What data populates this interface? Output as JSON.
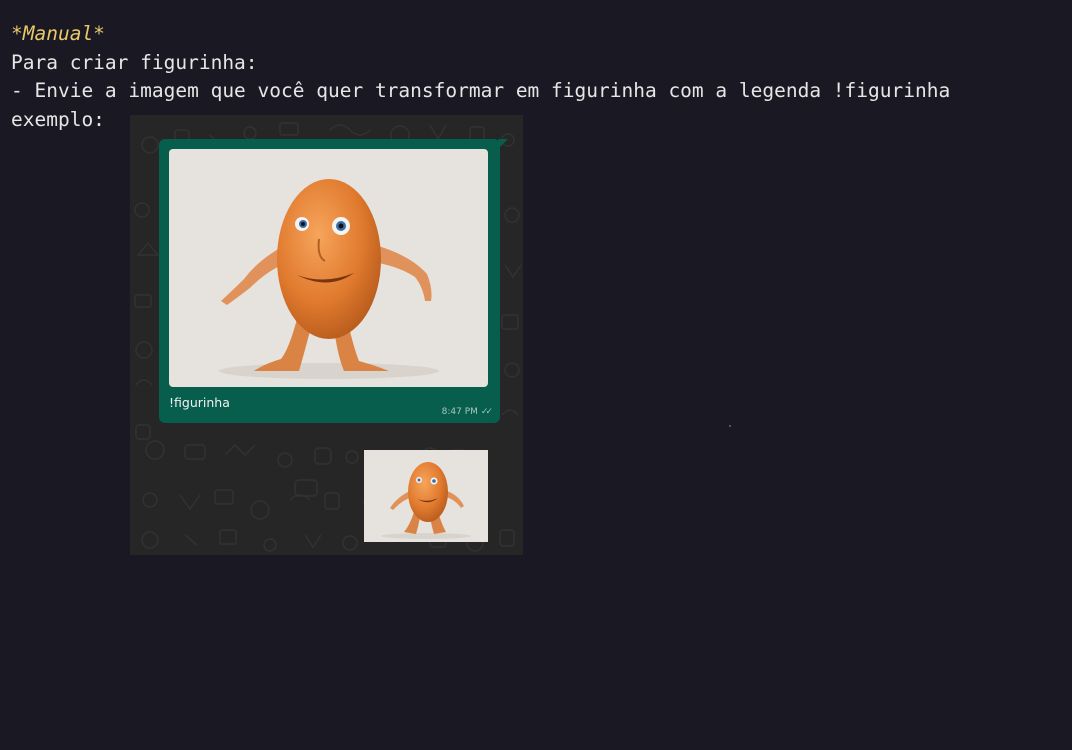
{
  "manual": {
    "title": "*Manual*",
    "line1": "Para criar figurinha:",
    "line2": "- Envie a imagem que você quer transformar em figurinha com a legenda !figurinha",
    "line3": "exemplo:"
  },
  "example": {
    "caption": "!figurinha",
    "time": "8:47 PM",
    "ticks": "✓✓",
    "main_image_icon": "orange-creature-image",
    "sticker_icon": "orange-creature-sticker"
  },
  "colors": {
    "background": "#1a1823",
    "title": "#e8c96a",
    "bubble": "#075e4c",
    "chat_bg": "#262627"
  }
}
